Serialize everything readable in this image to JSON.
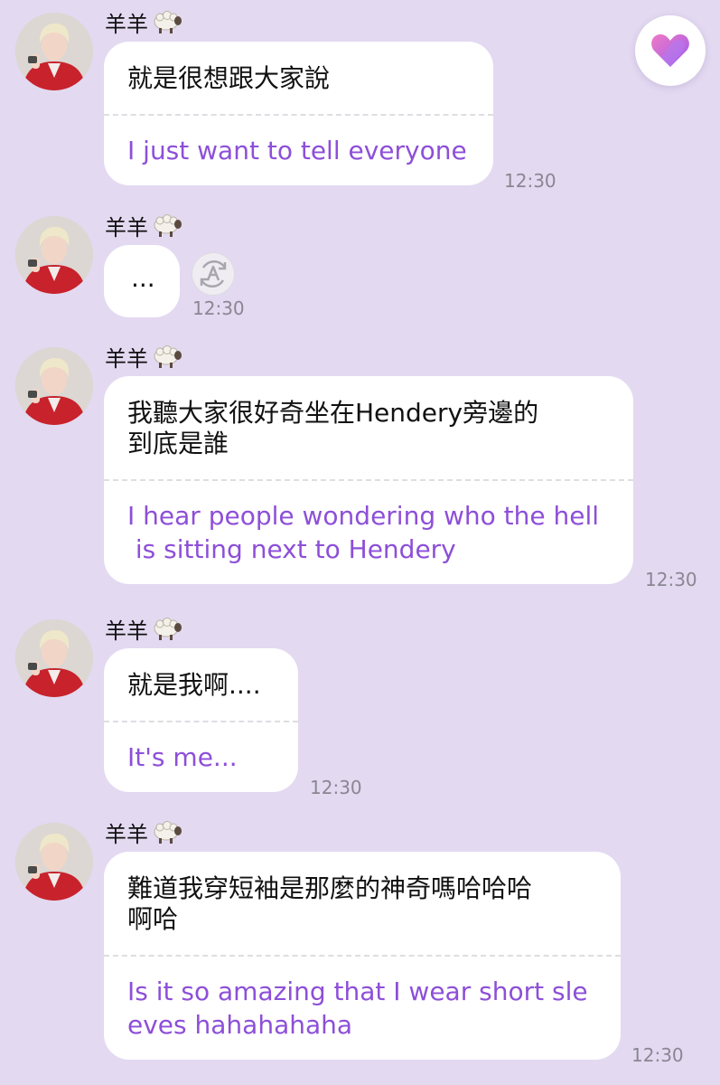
{
  "sender": {
    "name": "羊羊",
    "emoji_icon": "sheep-icon"
  },
  "messages": [
    {
      "original": "就是很想跟大家說",
      "translation": "I just want to tell everyone",
      "time": "12:30"
    },
    {
      "original": "...",
      "translation": "",
      "time": "12:30"
    },
    {
      "original": "我聽大家很好奇坐在Hendery旁邊的\n到底是誰",
      "translation": "I hear people wondering who the hell\n is sitting next to Hendery",
      "time": "12:30"
    },
    {
      "original": "就是我啊....",
      "translation": "It's me...",
      "time": "12:30"
    },
    {
      "original": "難道我穿短袖是那麼的神奇嗎哈哈哈\n啊哈",
      "translation": "Is it so amazing that I wear short sle\neves hahahahaha",
      "time": "12:30"
    }
  ],
  "colors": {
    "background": "#e3d9f1",
    "bubble": "#ffffff",
    "translation_text": "#8d4fd8",
    "timestamp": "#8a8692"
  },
  "icons": {
    "heart_button": "heart-icon",
    "translate_button": "translate-icon"
  }
}
